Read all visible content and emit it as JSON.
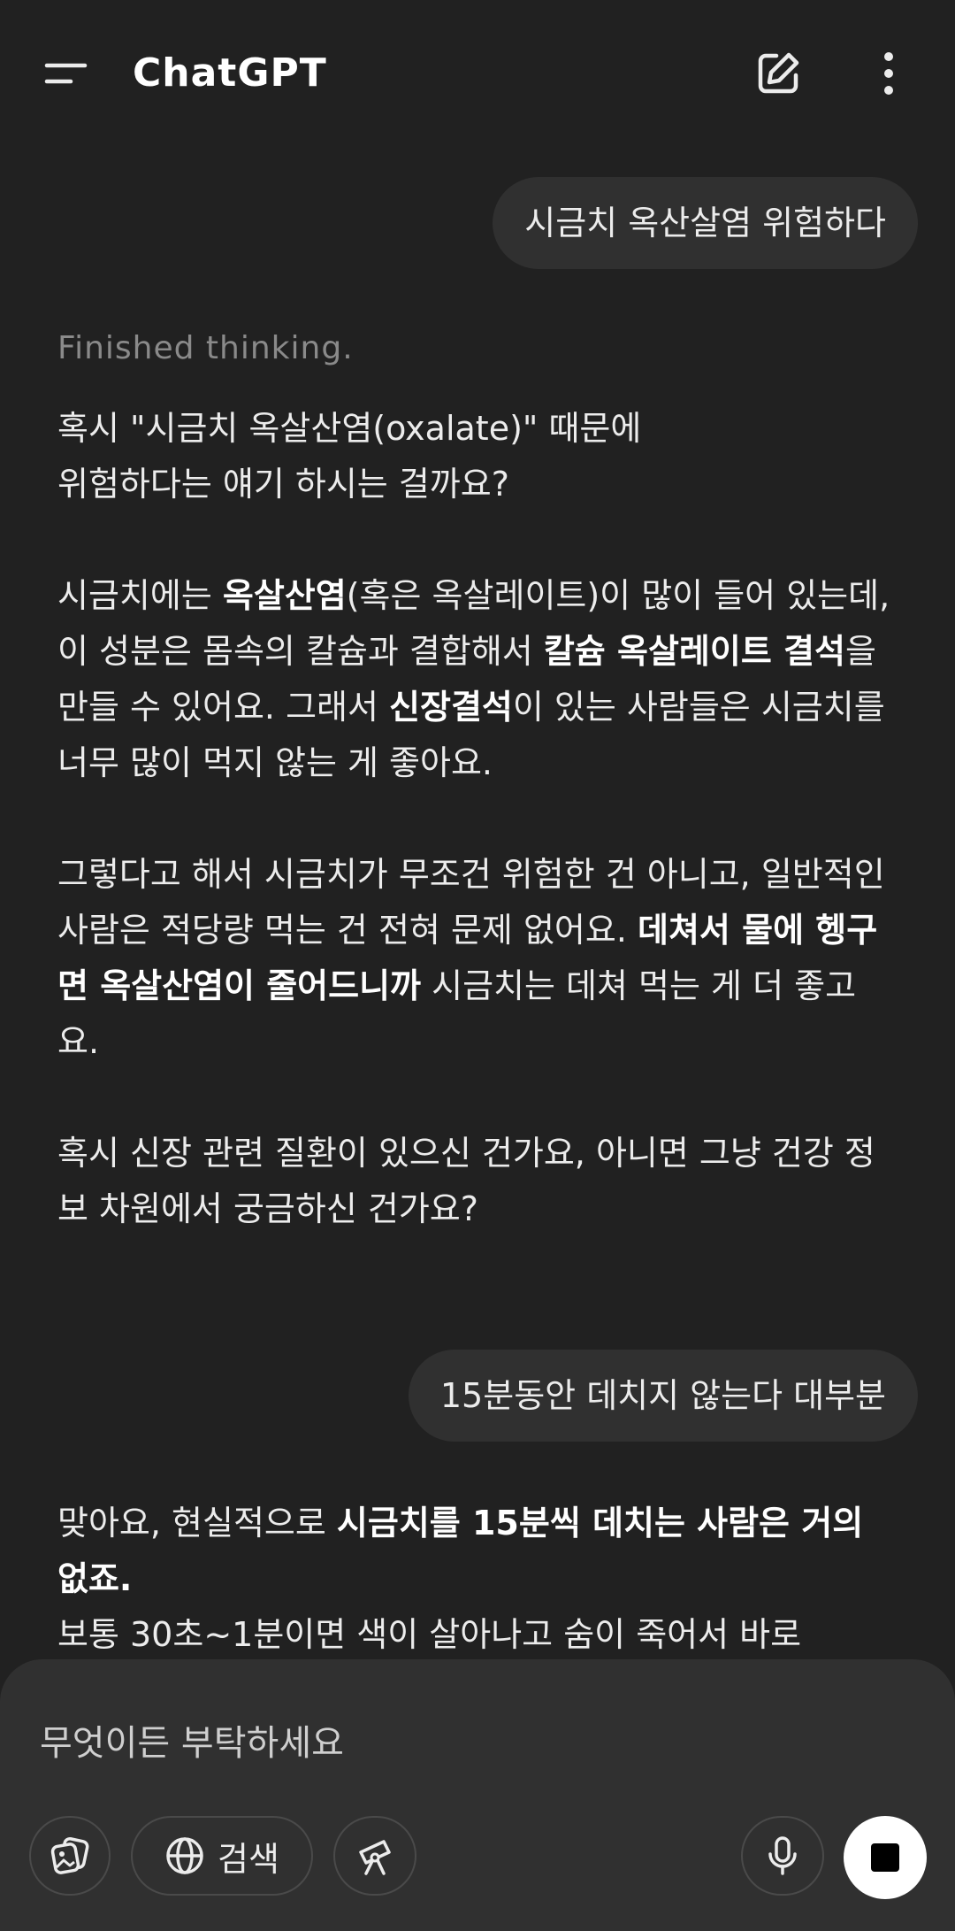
{
  "header": {
    "title": "ChatGPT"
  },
  "messages": {
    "user_1": "시금치 옥산살염 위험하다",
    "thinking": "Finished thinking.",
    "assistant_1": {
      "p1_a": "혹시 \"시금치 옥살산염(oxalate)\" 때문에",
      "p1_b": "위험하다는 얘기 하시는 걸까요?",
      "p2_pre": "시금치에는 ",
      "p2_b1": "옥살산염",
      "p2_mid1": "(혹은 옥살레이트)이 많이 들어 있는데, 이 성분은 몸속의 칼슘과 결합해서 ",
      "p2_b2": "칼슘 옥살레이트 결석",
      "p2_mid2": "을 만들 수 있어요. 그래서 ",
      "p2_b3": "신장결석",
      "p2_post": "이 있는 사람들은 시금치를 너무 많이 먹지 않는 게 좋아요.",
      "p3_a": "그렇다고 해서 시금치가 무조건 위험한 건 아니고, 일반적인 사람은 적당량 먹는 건 전혀 문제 없어요. ",
      "p3_b": "데쳐서 물에 헹구면 옥살산염이 줄어드니까",
      "p3_c": " 시금치는 데쳐 먹는 게 더 좋고요.",
      "p4": "혹시 신장 관련 질환이 있으신 건가요, 아니면 그냥 건강 정보 차원에서 궁금하신 건가요?"
    },
    "user_2": "15분동안 데치지 않는다 대부분",
    "assistant_2": {
      "a": "맞아요, 현실적으로 ",
      "b": "시금치를 15분씩 데치는 사람은 거의 없죠.",
      "c": "보통 30초~1분이면 색이 살아나고 숨이 죽어서 바로"
    }
  },
  "composer": {
    "placeholder": "무엇이든 부탁하세요",
    "search_label": "검색"
  }
}
